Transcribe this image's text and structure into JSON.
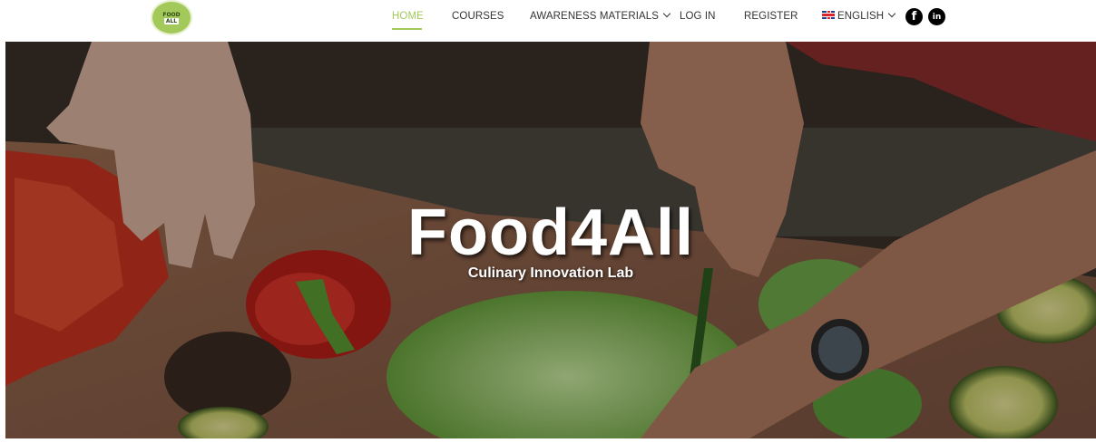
{
  "logo": {
    "line1": "FOOD",
    "line2": "ALL"
  },
  "nav": {
    "home": "HOME",
    "courses": "COURSES",
    "awareness": "AWARENESS MATERIALS",
    "login": "LOG IN",
    "register": "REGISTER",
    "language": "ENGLISH"
  },
  "social": {
    "facebook": "f",
    "linkedin": "in"
  },
  "hero": {
    "title": "Food4All",
    "subtitle": "Culinary Innovation Lab"
  },
  "colors": {
    "accent": "#a3c95a",
    "text": "#333333"
  }
}
